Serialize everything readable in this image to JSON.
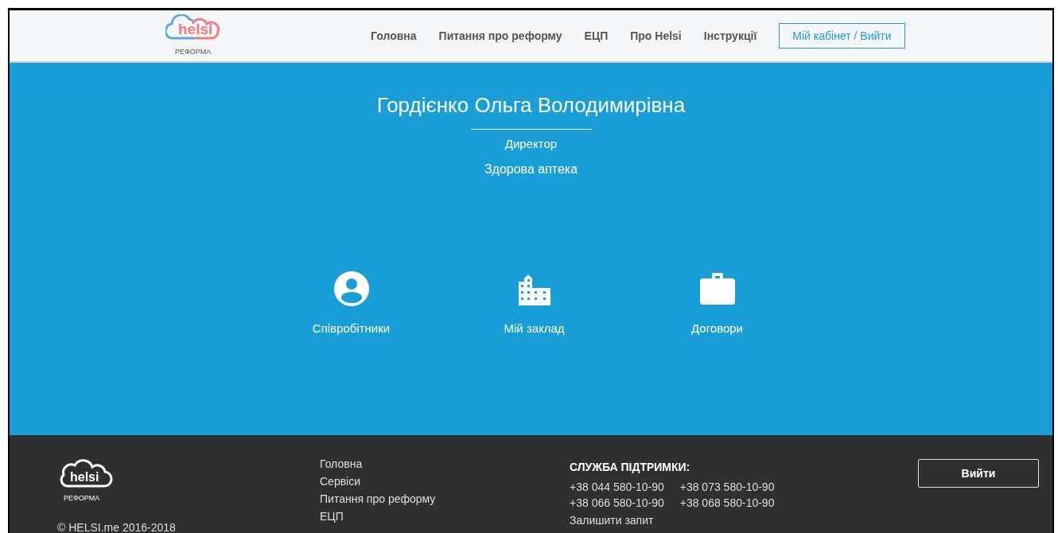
{
  "header": {
    "logo_caption": "РЕФОРМА",
    "logo_word": "helsi",
    "nav": [
      "Головна",
      "Питання про реформу",
      "ЕЦП",
      "Про Helsi",
      "Інструкції"
    ],
    "account_button": "Мій кабінет / Вийти"
  },
  "profile": {
    "name": "Гордієнко Ольга Володимирівна",
    "position": "Директор",
    "organization": "Здорова аптека"
  },
  "tiles": [
    {
      "kind": "person",
      "label": "Співробітники"
    },
    {
      "kind": "building",
      "label": "Мій заклад"
    },
    {
      "kind": "briefcase",
      "label": "Договори"
    }
  ],
  "footer": {
    "logo_word": "helsi",
    "logo_caption": "РЕФОРМА",
    "copyright": "© HELSI.me 2016-2018",
    "links": [
      "Головна",
      "Сервіси",
      "Питання про реформу",
      "ЕЦП"
    ],
    "support_title": "СЛУЖБА ПІДТРИМКИ:",
    "phones": [
      "+38 044 580-10-90",
      "+38 073 580-10-90",
      "+38 066 580-10-90",
      "+38 068 580-10-90"
    ],
    "request_link": "Залишити запит",
    "logout_button": "Вийти"
  }
}
